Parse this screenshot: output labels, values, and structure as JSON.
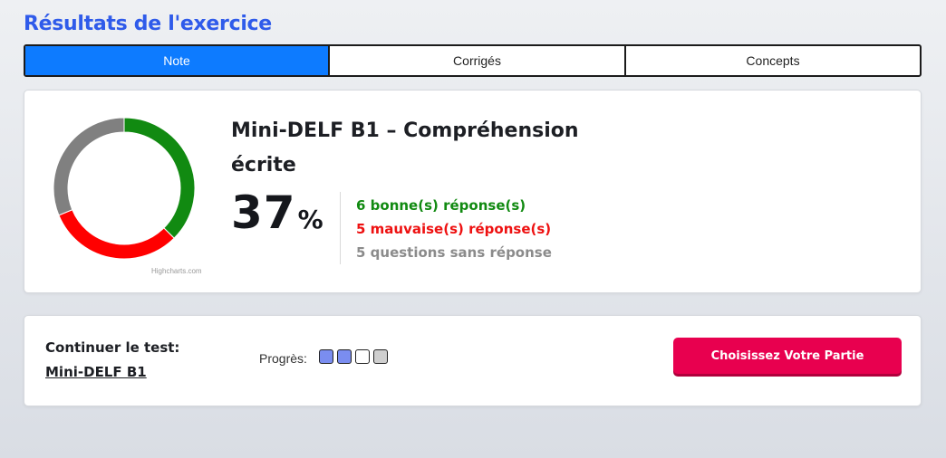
{
  "page": {
    "title": "Résultats de l'exercice"
  },
  "tabs": [
    {
      "label": "Note",
      "active": true
    },
    {
      "label": "Corrigés",
      "active": false
    },
    {
      "label": "Concepts",
      "active": false
    }
  ],
  "score_card": {
    "test_title": "Mini-DELF B1 – Compréhension écrite",
    "score_value": "37",
    "score_unit": "%",
    "stats": {
      "good": "6 bonne(s) réponse(s)",
      "bad": "5 mauvaise(s) réponse(s)",
      "none": "5 questions sans réponse"
    },
    "chart_credit": "Highcharts.com"
  },
  "chart_data": {
    "type": "pie",
    "categories": [
      "bonne(s) réponse(s)",
      "mauvaise(s) réponse(s)",
      "sans réponse"
    ],
    "values": [
      6,
      5,
      5
    ],
    "colors": [
      "#118a11",
      "#ff0000",
      "#808080"
    ],
    "donut": true
  },
  "continue_card": {
    "label": "Continuer le test:",
    "link": "Mini-DELF B1",
    "progress_label": "Progrès:",
    "progress_steps": [
      "done",
      "done",
      "current",
      "todo"
    ],
    "cta_label": "Choisissez Votre Partie"
  },
  "colors": {
    "accent": "#2f5bea",
    "tab_active": "#0d7bff",
    "cta": "#e8004f",
    "progress_done": "#7a8df0"
  }
}
